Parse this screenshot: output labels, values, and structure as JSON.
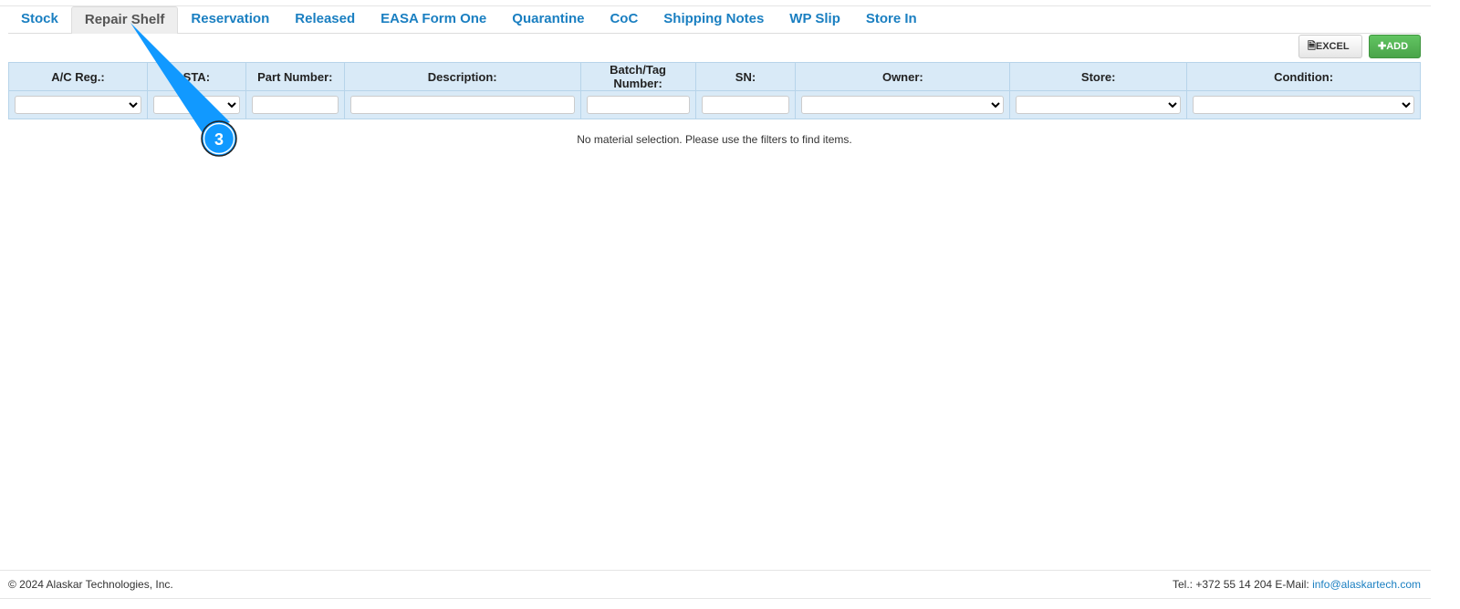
{
  "tabs": [
    {
      "label": "Stock"
    },
    {
      "label": "Repair Shelf"
    },
    {
      "label": "Reservation"
    },
    {
      "label": "Released"
    },
    {
      "label": "EASA Form One"
    },
    {
      "label": "Quarantine"
    },
    {
      "label": "CoC"
    },
    {
      "label": "Shipping Notes"
    },
    {
      "label": "WP Slip"
    },
    {
      "label": "Store In"
    }
  ],
  "active_tab": "Repair Shelf",
  "toolbar": {
    "excel_label": "EXCEL",
    "add_label": "ADD"
  },
  "columns": [
    {
      "label": "A/C Reg.:",
      "filter": "select"
    },
    {
      "label": "STA:",
      "filter": "select"
    },
    {
      "label": "Part Number:",
      "filter": "input"
    },
    {
      "label": "Description:",
      "filter": "input"
    },
    {
      "label": "Batch/Tag Number:",
      "filter": "input"
    },
    {
      "label": "SN:",
      "filter": "input"
    },
    {
      "label": "Owner:",
      "filter": "select"
    },
    {
      "label": "Store:",
      "filter": "select"
    },
    {
      "label": "Condition:",
      "filter": "select"
    }
  ],
  "empty_message": "No material selection. Please use the filters to find items.",
  "callout": {
    "number": "3",
    "color": "#1199ff"
  },
  "footer": {
    "copyright": "© 2024 Alaskar Technologies, Inc.",
    "contact": "Tel.: +372 55 14 204 E-Mail: ",
    "email": "info@alaskartech.com"
  }
}
